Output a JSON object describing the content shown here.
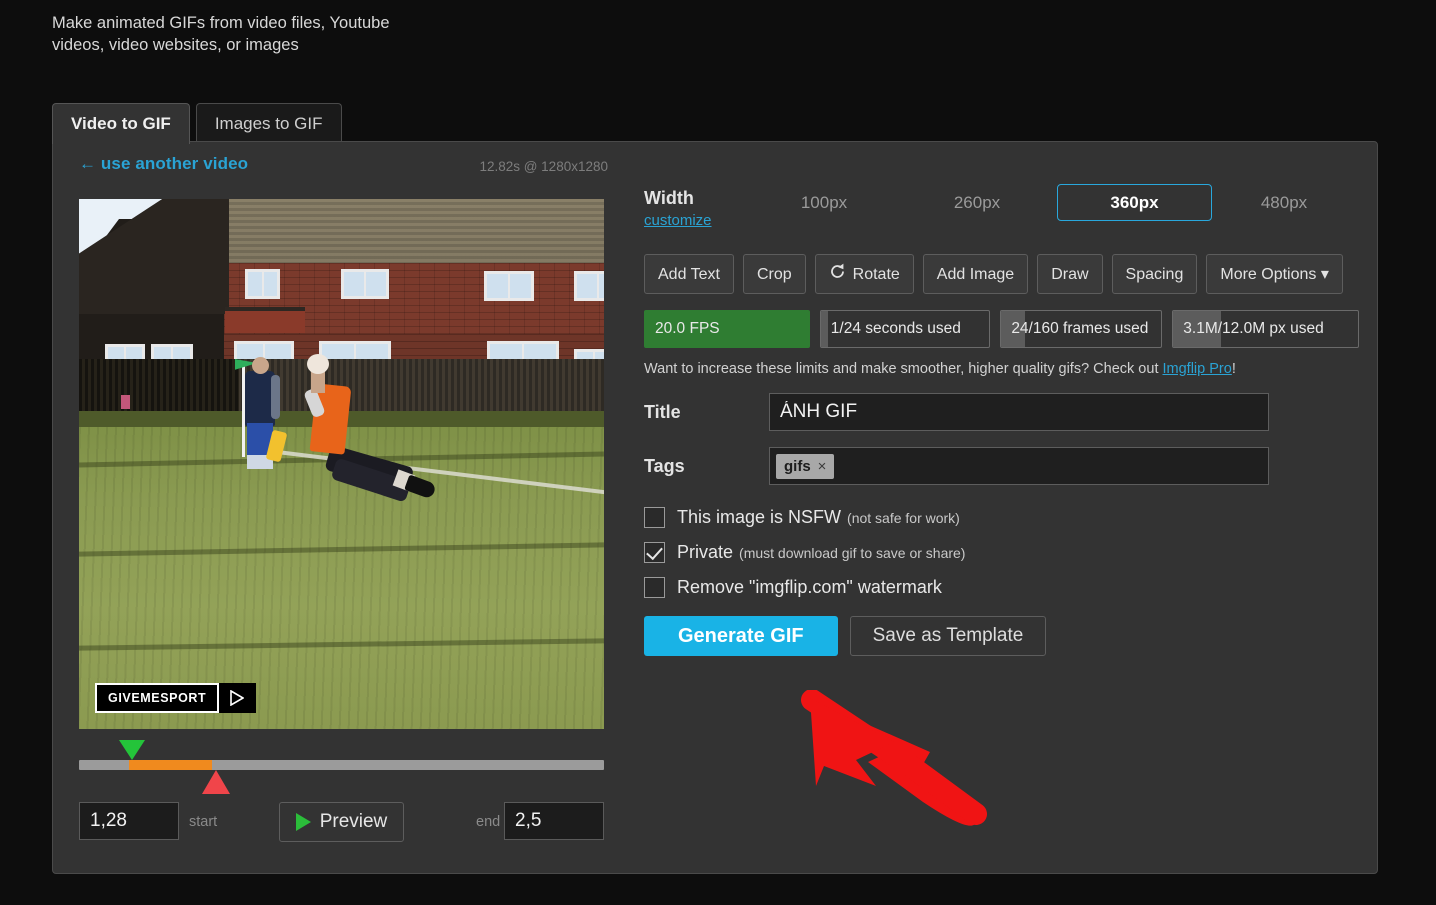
{
  "page": {
    "tagline": "Make animated GIFs from video files, Youtube videos, video websites, or images"
  },
  "tabs": [
    {
      "label": "Video to GIF",
      "active": true
    },
    {
      "label": "Images to GIF",
      "active": false
    }
  ],
  "video_panel": {
    "use_another_label": "← use another video",
    "meta": "12.82s @ 1280x1280",
    "watermark_text": "GIVEMESPORT",
    "watermark_play_icon": "play-icon"
  },
  "timeline": {
    "start_value": "1,28",
    "start_label": "start",
    "end_label": "end",
    "end_value": "2,5",
    "preview_label": "Preview",
    "preview_icon": "play-triangle-icon",
    "start_marker_pct": 10,
    "end_marker_pct": 26,
    "track_fill_start_pct": 9.5,
    "track_fill_end_pct": 25.3,
    "marker_start_color": "#24c43a",
    "marker_end_color": "#f0454a",
    "selection_color": "#f08a1e"
  },
  "width": {
    "label": "Width",
    "customize_label": "customize",
    "options": [
      {
        "label": "100px",
        "selected": false
      },
      {
        "label": "260px",
        "selected": false
      },
      {
        "label": "360px",
        "selected": true
      },
      {
        "label": "480px",
        "selected": false
      }
    ],
    "selected_value": "360px",
    "accent_color": "#29a8dd"
  },
  "tools": [
    {
      "label": "Add Text",
      "icon": null
    },
    {
      "label": "Crop",
      "icon": null
    },
    {
      "label": "Rotate",
      "icon": "rotate-icon"
    },
    {
      "label": "Add Image",
      "icon": null
    },
    {
      "label": "Draw",
      "icon": null
    },
    {
      "label": "Spacing",
      "icon": null
    },
    {
      "label": "More Options ▾",
      "icon": "chevron-down-icon"
    }
  ],
  "stats": [
    {
      "label": "20.0 FPS",
      "fill_pct": 100,
      "highlight": true
    },
    {
      "label": "1/24 seconds used",
      "fill_pct": 4,
      "highlight": false
    },
    {
      "label": "24/160 frames used",
      "fill_pct": 15,
      "highlight": false
    },
    {
      "label": "3.1M/12.0M px used",
      "fill_pct": 26,
      "highlight": false
    }
  ],
  "pro_notice": {
    "text_before": "Want to increase these limits and make smoother, higher quality gifs? Check out ",
    "link_text": "Imgflip Pro",
    "text_after": "!"
  },
  "fields": {
    "title_label": "Title",
    "title_value": "ÁNH GIF",
    "tags_label": "Tags",
    "tags": [
      {
        "label": "gifs",
        "remove_icon": "×"
      }
    ]
  },
  "checkboxes": [
    {
      "main": "This image is NSFW",
      "sub": "(not safe for work)",
      "checked": false
    },
    {
      "main": "Private",
      "sub": "(must download gif to save or share)",
      "checked": true
    },
    {
      "main": "Remove \"imgflip.com\" watermark",
      "sub": "",
      "checked": false
    }
  ],
  "actions": {
    "generate_label": "Generate GIF",
    "template_label": "Save as Template",
    "generate_color": "#19b3e6"
  },
  "annotation": {
    "arrow_color": "#f01414",
    "arrow_name": "red-pointer-arrow"
  }
}
